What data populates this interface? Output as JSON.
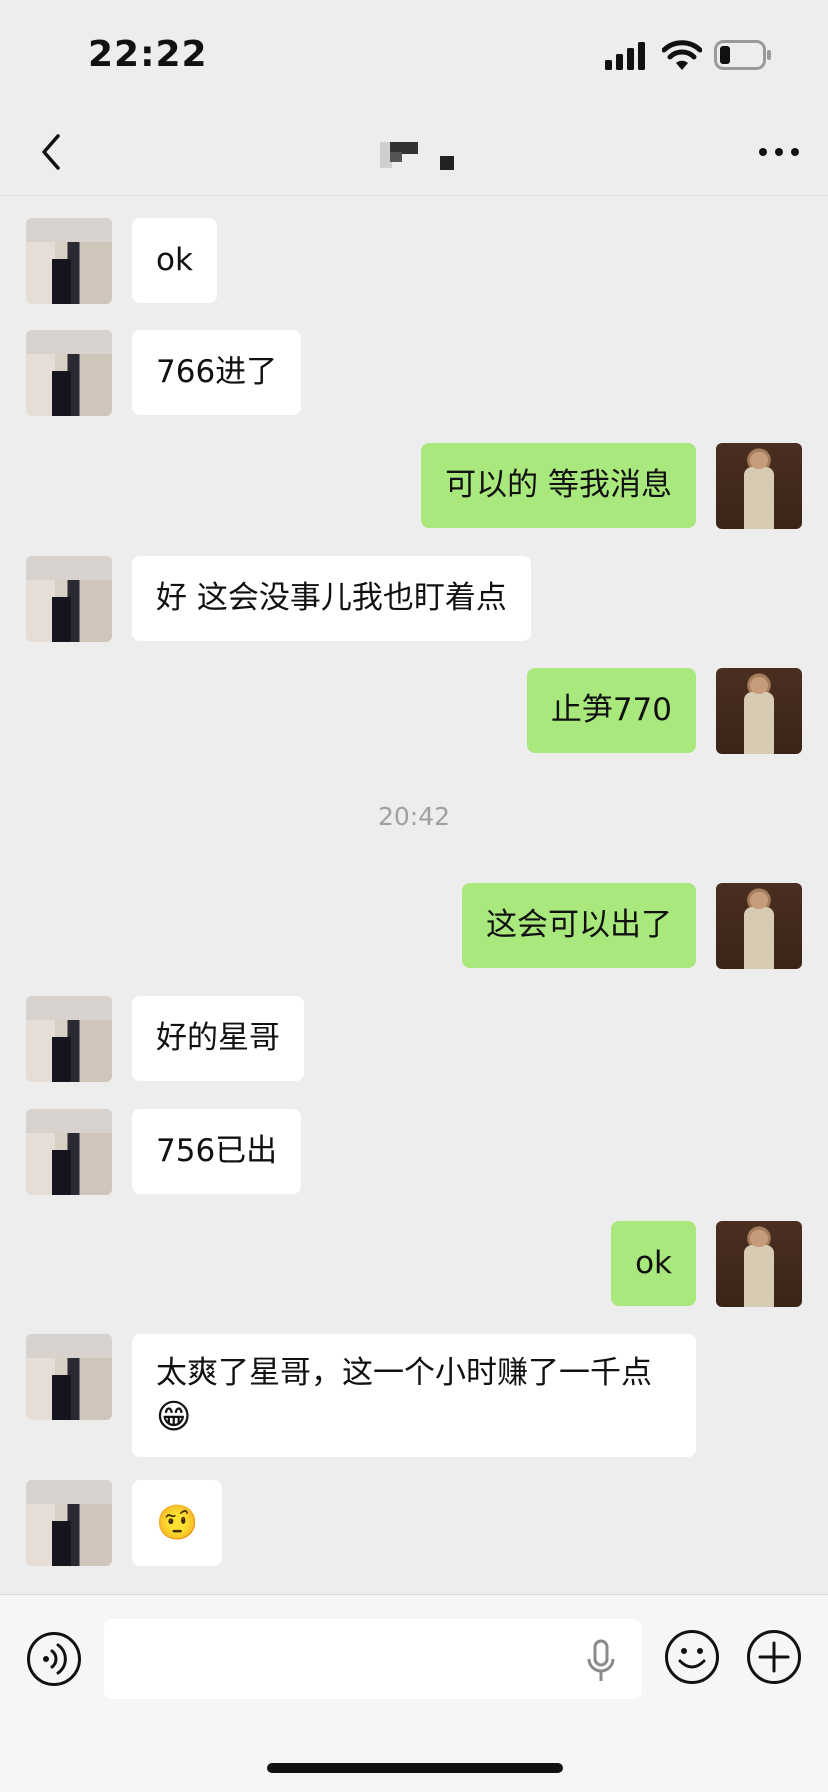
{
  "status_bar": {
    "time": "22:22"
  },
  "nav": {
    "title": ""
  },
  "messages": [
    {
      "dir": "in",
      "text": "ok"
    },
    {
      "dir": "in",
      "text": "766进了"
    },
    {
      "dir": "out",
      "text": "可以的 等我消息"
    },
    {
      "dir": "in",
      "text": "好 这会没事儿我也盯着点"
    },
    {
      "dir": "out",
      "text": "止笋770"
    },
    {
      "dir": "out",
      "text": "这会可以出了"
    },
    {
      "dir": "in",
      "text": "好的星哥"
    },
    {
      "dir": "in",
      "text": "756已出"
    },
    {
      "dir": "out",
      "text": "ok"
    },
    {
      "dir": "in",
      "text": "太爽了星哥，这一个小时赚了一千点",
      "emoji": "😁"
    },
    {
      "dir": "in",
      "text": "",
      "emoji": "🤨"
    }
  ],
  "time_separator": "20:42",
  "input_bar": {
    "placeholder": ""
  },
  "colors": {
    "background": "#ededed",
    "outgoing_bubble": "#a9e87c",
    "incoming_bubble": "#ffffff",
    "timestamp": "#a0a0a0"
  }
}
